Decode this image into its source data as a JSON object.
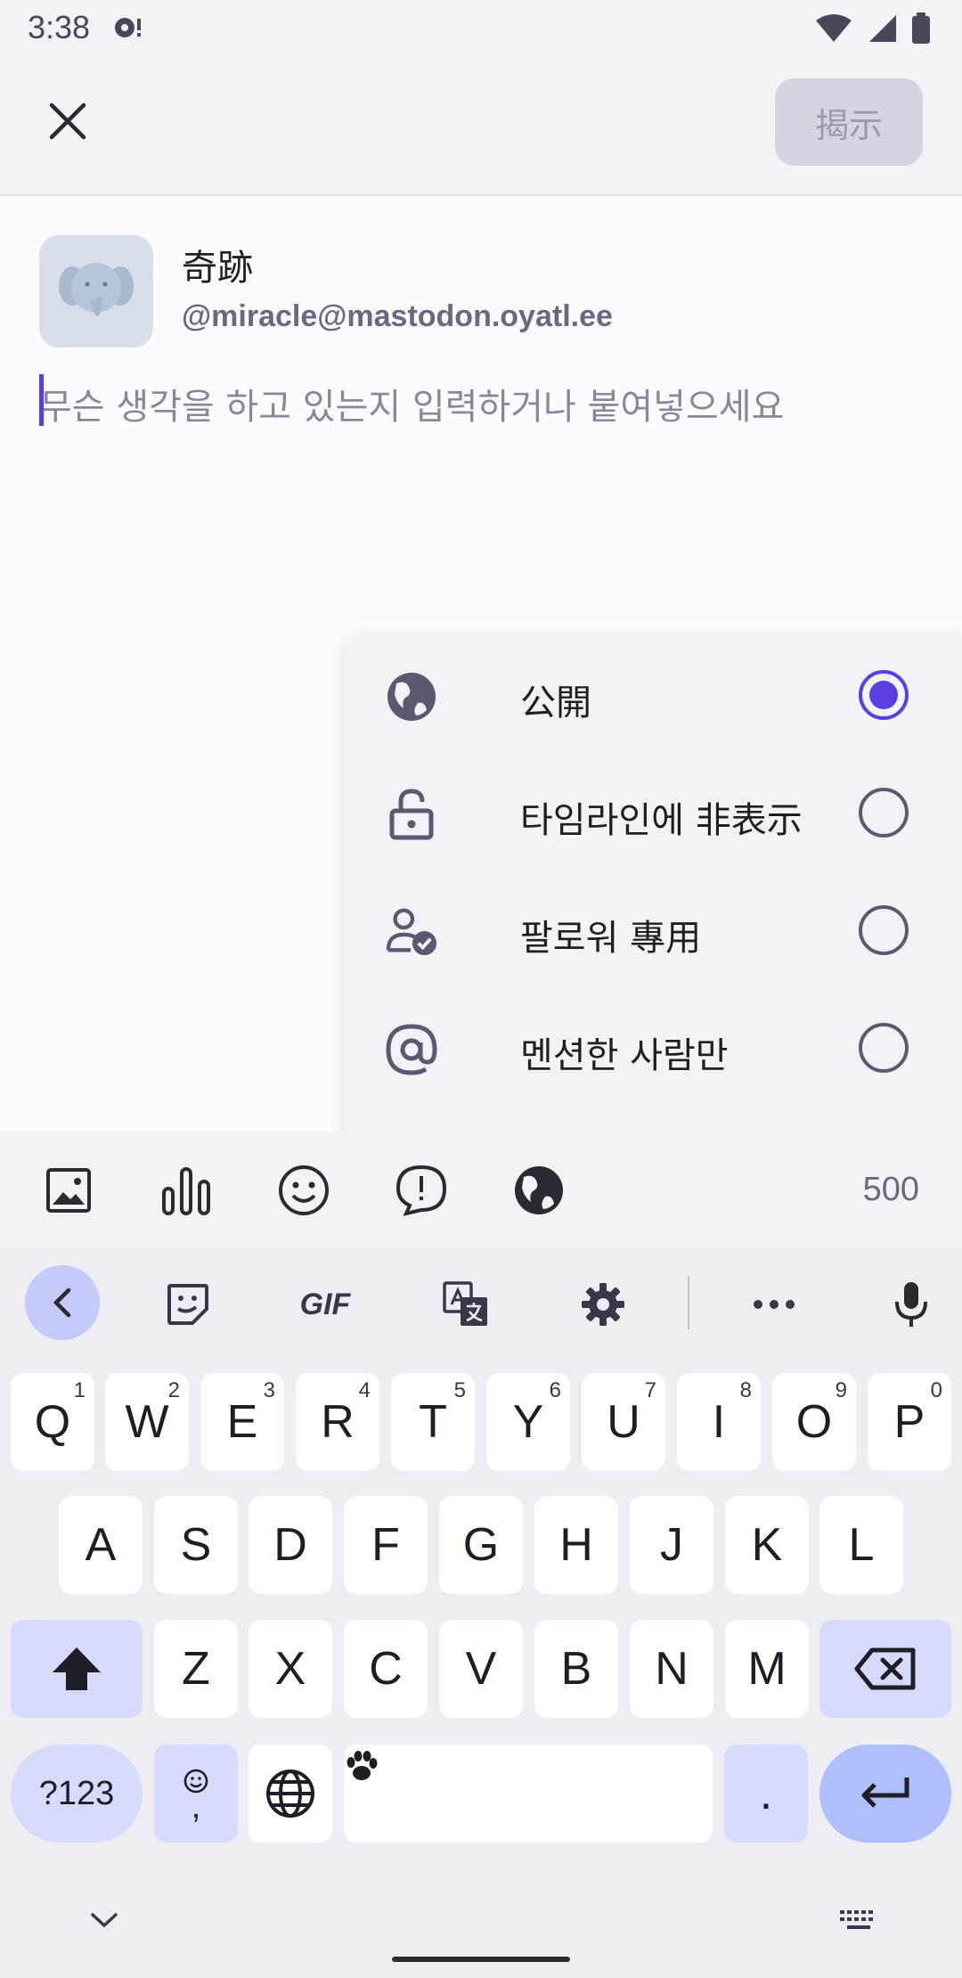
{
  "status_bar": {
    "time": "3:38"
  },
  "app_bar": {
    "post_label": "揭示"
  },
  "account": {
    "display_name": "奇跡",
    "handle": "@miracle@mastodon.oyatl.ee"
  },
  "compose": {
    "placeholder": "무슨 생각을 하고 있는지 입력하거나 붙여넣으세요",
    "value": ""
  },
  "visibility_menu": {
    "items": [
      {
        "label": "公開",
        "icon": "globe-icon",
        "selected": true
      },
      {
        "label": "타임라인에 非表示",
        "icon": "lock-icon",
        "selected": false
      },
      {
        "label": "팔로워 專用",
        "icon": "followers-icon",
        "selected": false
      },
      {
        "label": "멘션한 사람만",
        "icon": "at-icon",
        "selected": false
      }
    ]
  },
  "toolbar": {
    "char_count": "500",
    "tools": [
      "image-icon",
      "poll-icon",
      "emoji-icon",
      "content-warning-icon",
      "globe-icon"
    ]
  },
  "keyboard": {
    "strip": [
      "back-icon",
      "sticker-icon",
      "GIF",
      "translate-icon",
      "settings-icon",
      "more-icon",
      "mic-icon"
    ],
    "row1": [
      {
        "k": "Q",
        "h": "1"
      },
      {
        "k": "W",
        "h": "2"
      },
      {
        "k": "E",
        "h": "3"
      },
      {
        "k": "R",
        "h": "4"
      },
      {
        "k": "T",
        "h": "5"
      },
      {
        "k": "Y",
        "h": "6"
      },
      {
        "k": "U",
        "h": "7"
      },
      {
        "k": "I",
        "h": "8"
      },
      {
        "k": "O",
        "h": "9"
      },
      {
        "k": "P",
        "h": "0"
      }
    ],
    "row2": [
      "A",
      "S",
      "D",
      "F",
      "G",
      "H",
      "J",
      "K",
      "L"
    ],
    "row3": [
      "Z",
      "X",
      "C",
      "V",
      "B",
      "N",
      "M"
    ],
    "symbols_label": "?123",
    "comma_label": ",",
    "period_label": "."
  },
  "colors": {
    "accent": "#5b3ee0",
    "surface": "#f3f2f7",
    "key_mod": "#d6dafc"
  }
}
